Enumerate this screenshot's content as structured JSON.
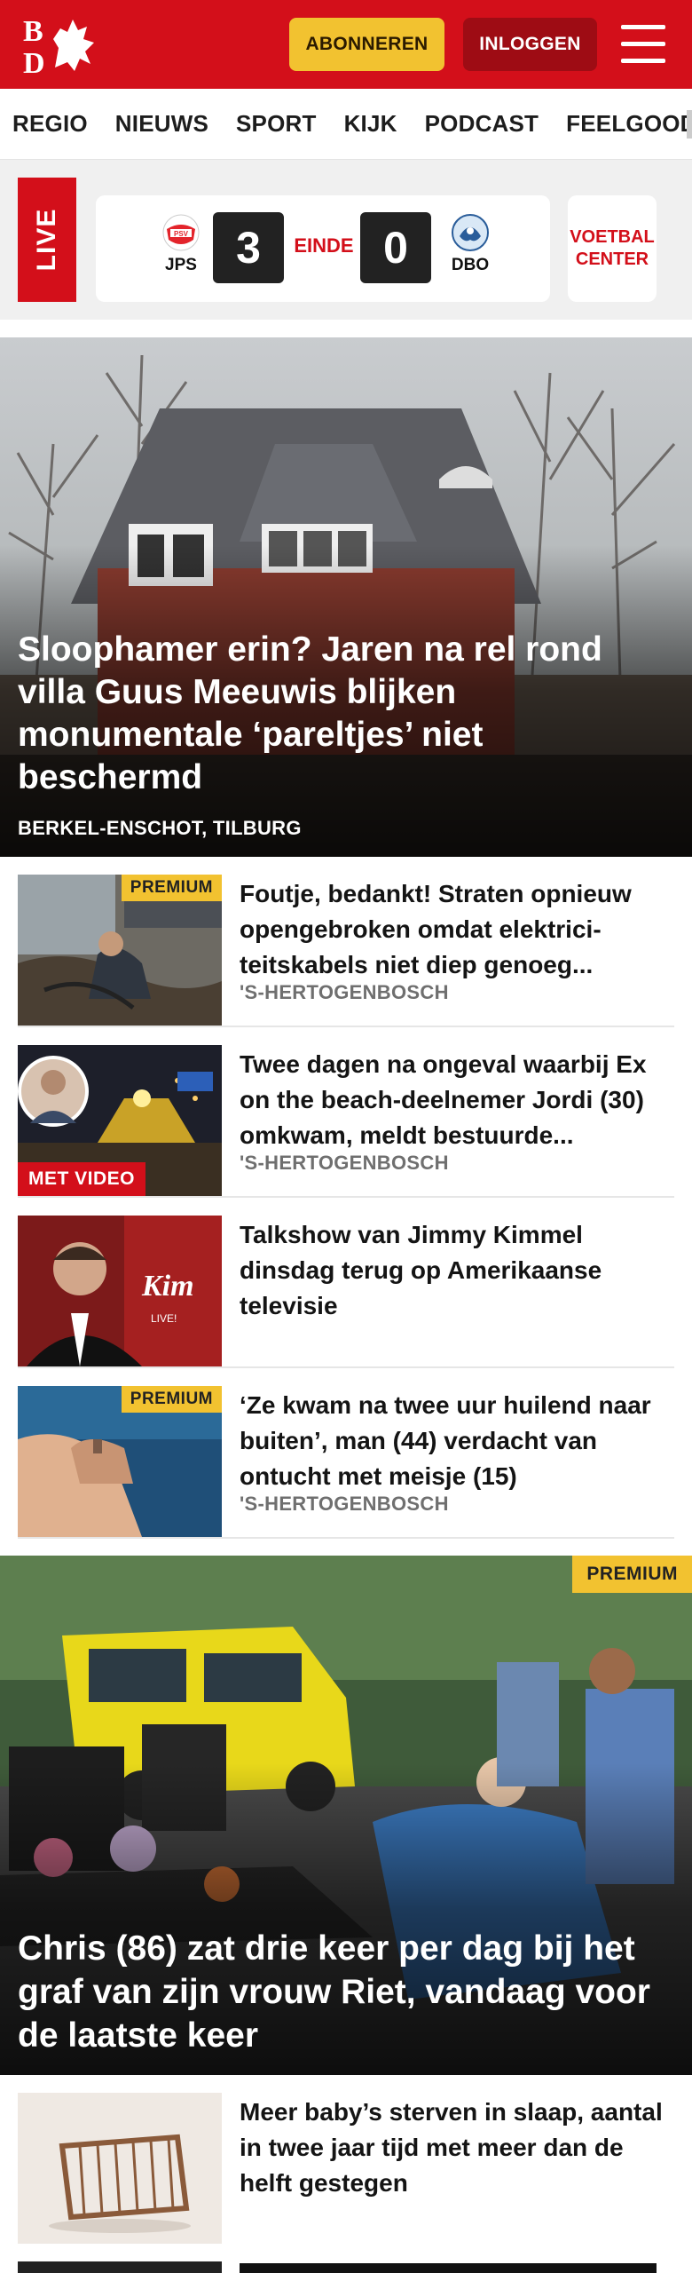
{
  "header": {
    "logo_text": "BD",
    "subscribe_label": "ABONNEREN",
    "login_label": "INLOGGEN",
    "menu_icon": "hamburger-menu-icon",
    "brand_color": "#d30f1a"
  },
  "nav": {
    "items": [
      "REGIO",
      "NIEUWS",
      "SPORT",
      "KIJK",
      "PODCAST",
      "FEELGOOD"
    ]
  },
  "live": {
    "badge": "LIVE",
    "home_team": "JPS",
    "home_score": "3",
    "status": "EINDE",
    "away_score": "0",
    "away_team": "DBO",
    "voetbal_center_line1": "VOETBAL",
    "voetbal_center_line2": "CENTER"
  },
  "hero": {
    "title": "Sloophamer erin? Jaren na rel rond villa Guus Meeuwis blijken monumentale ‘pareltjes’ niet beschermd",
    "location": "BERKEL-ENSCHOT, TILBURG"
  },
  "articles": [
    {
      "title": "Foutje, bedankt! Straten opnieuw opengebroken omdat elektrici­teitskabels niet diep genoeg...",
      "location": "'S-HERTOGENBOSCH",
      "badge": "PREMIUM"
    },
    {
      "title": "Twee dagen na ongeval waarbij Ex on the beach-deelnemer Jordi (30) omkwam, meldt bestuurde...",
      "location": "'S-HERTOGENBOSCH",
      "badge": "MET VIDEO"
    },
    {
      "title": "Talkshow van Jimmy Kimmel dinsdag terug op Amerikaanse televisie",
      "location": "",
      "badge": ""
    },
    {
      "title": "‘Ze kwam na twee uur huilend naar buiten’, man (44) verdacht van ontucht met meisje (15)",
      "location": "'S-HERTOGENBOSCH",
      "badge": "PREMIUM"
    }
  ],
  "feature": {
    "title": "Chris (86) zat drie keer per dag bij het graf van zijn vrouw Riet, vandaag voor de laatste keer",
    "badge": "PREMIUM"
  },
  "article_last": {
    "title": "Meer baby’s sterven in slaap, aantal in twee jaar tijd met meer dan de helft gestegen"
  }
}
